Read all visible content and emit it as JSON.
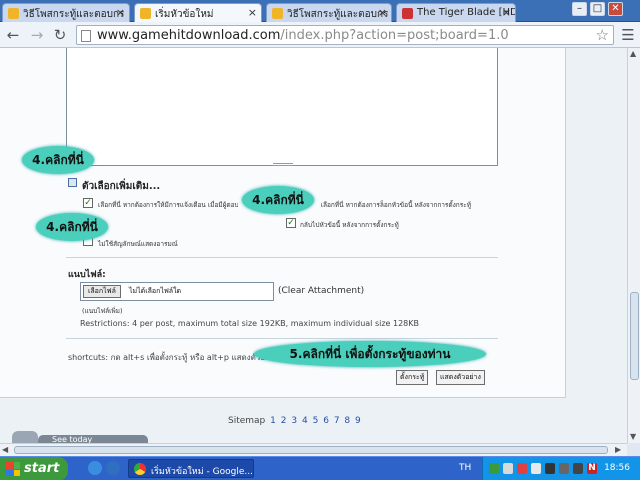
{
  "browser": {
    "tabs": [
      {
        "label": "วิธีโพสกระทู้และตอบกร"
      },
      {
        "label": "เริ่มหัวข้อใหม่"
      },
      {
        "label": "วิธีโพสกระทู้และตอบกร"
      },
      {
        "label": "The Tiger Blade [HD]("
      }
    ],
    "tab_close_glyph": "×",
    "url_host": "www.gamehitdownload.com",
    "url_path": "/index.php?action=post;board=1.0",
    "window_controls": {
      "minimize": "–",
      "maximize": "□",
      "close": "✕"
    }
  },
  "post_form": {
    "more_options_title": "ตัวเลือกเพิ่มเติม...",
    "options": [
      {
        "label": "เลือกที่นี่ หากต้องการให้มีการแจ้งเตือน เมื่อมีผู้ตอบกระทู้",
        "checked": true
      },
      {
        "label": "เลือกที่นี่ หากต้องการล็อกหัวข้อนี้ หลังจากการตั้งกระทู้",
        "checked": false
      },
      {
        "label": "กลับไปหัวข้อนี้ หลังจากการตั้งกระทู้",
        "checked": true
      },
      {
        "label": "ไม่ใช้สัญลักษณ์แสดงอารมณ์",
        "checked": false
      }
    ],
    "attachments": {
      "title": "แนบไฟล์:",
      "choose_button": "เลือกไฟล์",
      "file_status": "ไม่ได้เลือกไฟล์ใด",
      "clear": "(Clear Attachment)",
      "more": "(แนบไฟล์เพิ่ม)",
      "restrictions": "Restrictions: 4 per post, maximum total size 192KB, maximum individual size 128KB"
    },
    "shortcuts": "shortcuts: กด alt+s เพื่อตั้งกระทู้ หรือ alt+p แสดงตัวอย่าง",
    "submit_label": "ตั้งกระทู้",
    "preview_label": "แสดงตัวอย่าง"
  },
  "callouts": {
    "c1": "4.คลิกที่นี่",
    "c2": "4.คลิกที่นี่",
    "c3": "4.คลิกที่นี่",
    "c4": "5.คลิกที่นี่ เพื่อตั้งกระทู้ของท่าน"
  },
  "footer": {
    "sitemap_label": "Sitemap",
    "pages": [
      "1",
      "2",
      "3",
      "4",
      "5",
      "6",
      "7",
      "8",
      "9"
    ],
    "badge_text": "See today"
  },
  "taskbar": {
    "start_label": "start",
    "task_label": "เริ่มหัวข้อใหม่ - Google...",
    "language": "TH",
    "clock": "18:56"
  },
  "colors": {
    "callout": "#49cfbb",
    "taskbar": "#2e63c9",
    "start": "#3c9a3c",
    "tray": "#1294e8"
  }
}
